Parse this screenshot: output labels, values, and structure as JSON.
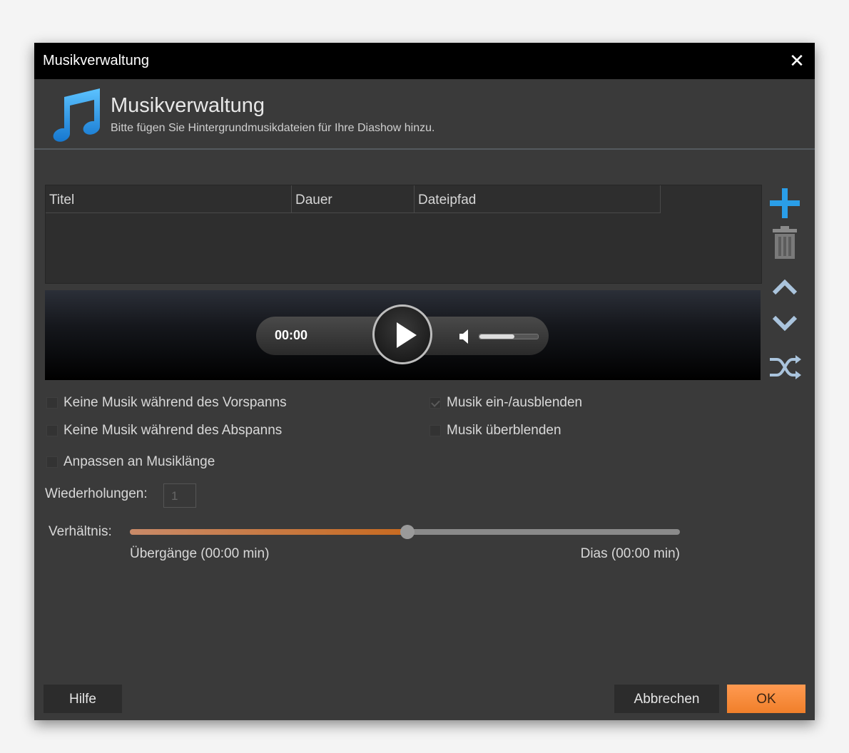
{
  "window": {
    "title": "Musikverwaltung"
  },
  "header": {
    "title": "Musikverwaltung",
    "subtitle": "Bitte fügen Sie Hintergrundmusikdateien für Ihre Diashow hinzu."
  },
  "table": {
    "columns": [
      "Titel",
      "Dauer",
      "Dateipfad"
    ],
    "rows": []
  },
  "player": {
    "time": "00:00",
    "volume_fraction": 0.6
  },
  "side_icons": [
    "add-icon",
    "trash-icon",
    "move-up-icon",
    "move-down-icon",
    "shuffle-icon"
  ],
  "options": {
    "no_music_intro": {
      "label": "Keine Musik während des Vorspanns",
      "checked": false
    },
    "no_music_outro": {
      "label": "Keine Musik während des Abspanns",
      "checked": false
    },
    "fit_music_length": {
      "label": "Anpassen an Musiklänge",
      "checked": false
    },
    "fade_music": {
      "label": "Musik ein-/ausblenden",
      "checked": true
    },
    "crossfade_music": {
      "label": "Musik überblenden",
      "checked": false
    }
  },
  "repeats": {
    "label": "Wiederholungen:",
    "value": "1"
  },
  "ratio": {
    "label": "Verhältnis:",
    "left_label": "Übergänge (00:00 min)",
    "right_label": "Dias (00:00 min)",
    "value_fraction": 0.505
  },
  "buttons": {
    "help": "Hilfe",
    "cancel": "Abbrechen",
    "ok": "OK"
  },
  "colors": {
    "accent_blue": "#2a9ee8",
    "ok_orange": "#f5893a",
    "slider_fill": "#c86a20"
  }
}
